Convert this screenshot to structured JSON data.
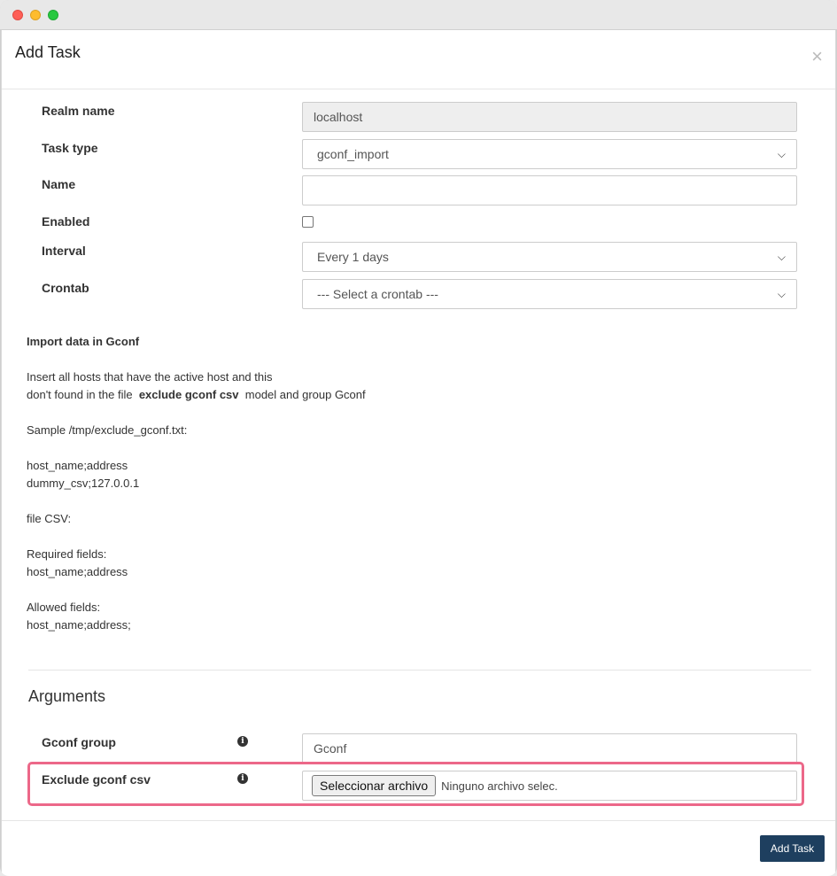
{
  "modal": {
    "title": "Add Task",
    "close_glyph": "×"
  },
  "fields": {
    "realm_name": {
      "label": "Realm name",
      "value": "localhost"
    },
    "task_type": {
      "label": "Task type",
      "value": "gconf_import"
    },
    "name": {
      "label": "Name",
      "value": ""
    },
    "enabled": {
      "label": "Enabled",
      "checked": false
    },
    "interval": {
      "label": "Interval",
      "value": "Every 1 days"
    },
    "crontab": {
      "label": "Crontab",
      "value": "--- Select a crontab ---"
    }
  },
  "help": {
    "title": "Import data in Gconf",
    "line1": "Insert all hosts that have the active host and this",
    "line2_pre": "don't found in the file",
    "line2_bold": "exclude gconf csv",
    "line2_post": "model and group Gconf",
    "sample": "Sample /tmp/exclude_gconf.txt:",
    "sample_header": "host_name;address",
    "sample_row": "dummy_csv;127.0.0.1",
    "file_csv": "file CSV:",
    "required_label": "Required fields:",
    "required_value": "host_name;address",
    "allowed_label": "Allowed fields:",
    "allowed_value": "host_name;address;"
  },
  "arguments": {
    "title": "Arguments",
    "gconf_group": {
      "label": "Gconf group",
      "value": "Gconf"
    },
    "exclude_csv": {
      "label": "Exclude gconf csv",
      "button": "Seleccionar archivo",
      "status": "Ninguno archivo selec."
    }
  },
  "footer": {
    "submit": "Add Task"
  },
  "colors": {
    "primary": "#1e3f5f",
    "highlight": "#ec6889"
  }
}
